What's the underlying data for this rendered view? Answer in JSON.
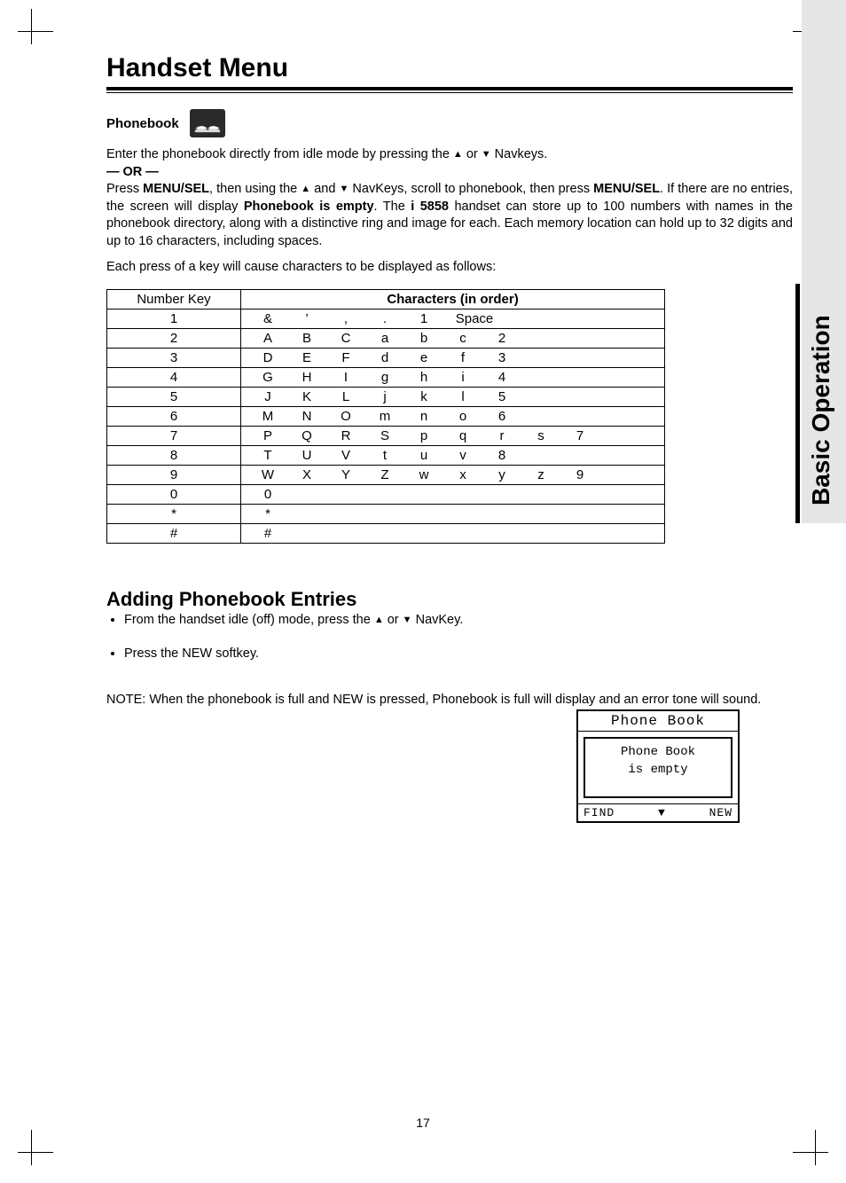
{
  "side_tab": "Basic Operation",
  "title": "Handset Menu",
  "phonebook": {
    "heading": "Phonebook",
    "icon_label": "Phone Book",
    "para1_pre": "Enter the phonebook directly from idle mode by pressing the ",
    "para1_mid": " or ",
    "para1_post": " Navkeys.",
    "or_line": "— OR —",
    "para2_a": "Press ",
    "para2_b": "MENU/SEL",
    "para2_c": ", then using the ",
    "para2_d": " and ",
    "para2_e": " NavKeys, scroll to phonebook, then press ",
    "para2_f": "MENU/SEL",
    "para2_g": ". If there are no entries, the screen will display ",
    "para2_h": "Phonebook is empty",
    "para2_i": ". The ",
    "para2_j": "i 5858",
    "para2_k": " handset can store up to 100 numbers with names in the phonebook directory, along with a distinctive ring and image for each. Each memory location can hold up to 32 digits and up to 16 characters, including spaces.",
    "para3": "Each press of a key will cause characters to be displayed as follows:"
  },
  "table": {
    "h1": "Number Key",
    "h2": "Characters (in order)"
  },
  "chart_data": {
    "type": "table",
    "columns": [
      "Number Key",
      "Characters (in order)"
    ],
    "rows": [
      {
        "key": "1",
        "chars": [
          "&",
          "’",
          ",",
          ".",
          "1",
          "Space"
        ]
      },
      {
        "key": "2",
        "chars": [
          "A",
          "B",
          "C",
          "a",
          "b",
          "c",
          "2"
        ]
      },
      {
        "key": "3",
        "chars": [
          "D",
          "E",
          "F",
          "d",
          "e",
          "f",
          "3"
        ]
      },
      {
        "key": "4",
        "chars": [
          "G",
          "H",
          "I",
          "g",
          "h",
          "i",
          "4"
        ]
      },
      {
        "key": "5",
        "chars": [
          "J",
          "K",
          "L",
          "j",
          "k",
          "l",
          "5"
        ]
      },
      {
        "key": "6",
        "chars": [
          "M",
          "N",
          "O",
          "m",
          "n",
          "o",
          "6"
        ]
      },
      {
        "key": "7",
        "chars": [
          "P",
          "Q",
          "R",
          "S",
          "p",
          "q",
          "r",
          "s",
          "7"
        ]
      },
      {
        "key": "8",
        "chars": [
          "T",
          "U",
          "V",
          "t",
          "u",
          "v",
          "8"
        ]
      },
      {
        "key": "9",
        "chars": [
          "W",
          "X",
          "Y",
          "Z",
          "w",
          "x",
          "y",
          "z",
          "9"
        ]
      },
      {
        "key": "0",
        "chars": [
          "0"
        ]
      },
      {
        "key": "*",
        "chars": [
          "*"
        ]
      },
      {
        "key": "#",
        "chars": [
          "#"
        ]
      }
    ]
  },
  "adding": {
    "heading": "Adding Phonebook Entries",
    "step1_a": "From the handset idle (off) mode, press the ",
    "step1_b": " or ",
    "step1_c": " NavKey.",
    "step2_a": "Press the ",
    "step2_b": "NEW",
    "step2_c": " softkey."
  },
  "lcd": {
    "title": "Phone Book",
    "line1": "Phone Book",
    "line2": "is empty",
    "left": "FIND",
    "right": "NEW"
  },
  "note": {
    "a": "NOTE:",
    "b": " When the phonebook is full and ",
    "c": "NEW",
    "d": " is pressed, ",
    "e": "Phonebook is full",
    "f": " will display and an error tone will sound."
  },
  "page_number": "17"
}
